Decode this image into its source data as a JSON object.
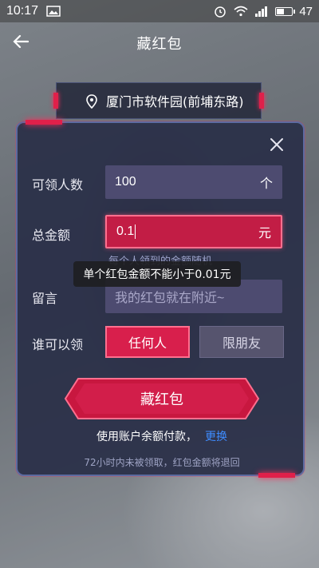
{
  "status_bar": {
    "time": "10:17",
    "battery_percent": "47",
    "battery_level": 0.47,
    "icons": [
      "image-icon",
      "alarm-icon",
      "wifi-icon",
      "signal-icon",
      "battery-icon"
    ]
  },
  "header": {
    "title": "藏红包",
    "back_icon": "back-arrow-icon"
  },
  "location": {
    "icon": "location-pin-icon",
    "text": "厦门市软件园(前埔东路)"
  },
  "form": {
    "count": {
      "label": "可领人数",
      "value": "100",
      "unit": "个"
    },
    "amount": {
      "label": "总金额",
      "value": "0.1",
      "unit": "元"
    },
    "amount_hint": "每个人领到的金额随机",
    "message": {
      "label": "留言",
      "placeholder": "我的红包就在附近~"
    },
    "who": {
      "label": "谁可以领",
      "options": [
        "任何人",
        "限朋友"
      ],
      "selected": "任何人"
    },
    "submit_label": "藏红包",
    "pay_text": "使用账户余额付款，",
    "pay_switch": "更换",
    "refund_note": "72小时内未被领取，红包金额将退回"
  },
  "toast": {
    "text": "单个红包金额不能小于0.01元"
  },
  "colors": {
    "accent": "#e0204a",
    "panel": "#2b3048",
    "link": "#3e8cff"
  }
}
